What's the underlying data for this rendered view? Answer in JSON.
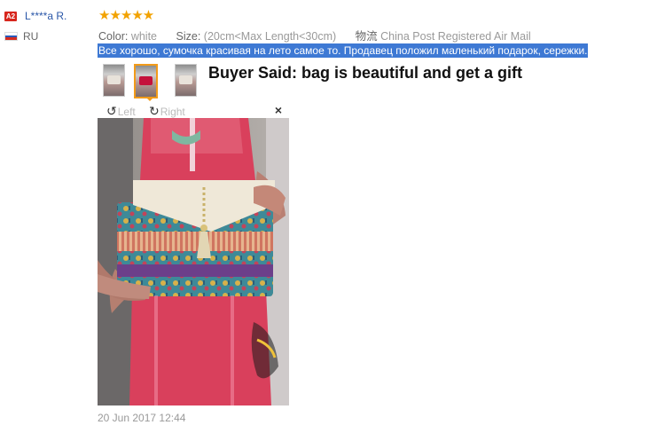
{
  "reviewer": {
    "badge": "A2",
    "name": "L****a R.",
    "country": "RU"
  },
  "rating": {
    "stars_display": "★★★★★",
    "value": 5,
    "max": 5
  },
  "meta": {
    "color_label": "Color:",
    "color_value": "white",
    "size_label": "Size:",
    "size_value": "(20cm<Max Length<30cm)",
    "shipping_label": "物流",
    "shipping_value": "China Post Registered Air Mail"
  },
  "review_text": "Все хорошо, сумочка красивая на лето самое то. Продавец положил маленький подарок, сережки.",
  "buyer_said": "Buyer Said: bag is beautiful and get a gift",
  "viewer": {
    "rotate_left_label": "Left",
    "rotate_right_label": "Right",
    "close_glyph": "×"
  },
  "date": "20 Jun 2017 12:44",
  "colors": {
    "stars": "#f2a200",
    "link": "#2a57a8",
    "badge": "#d7261d",
    "selection": "#3e79d4",
    "thumb_active_border": "#f29b19"
  }
}
